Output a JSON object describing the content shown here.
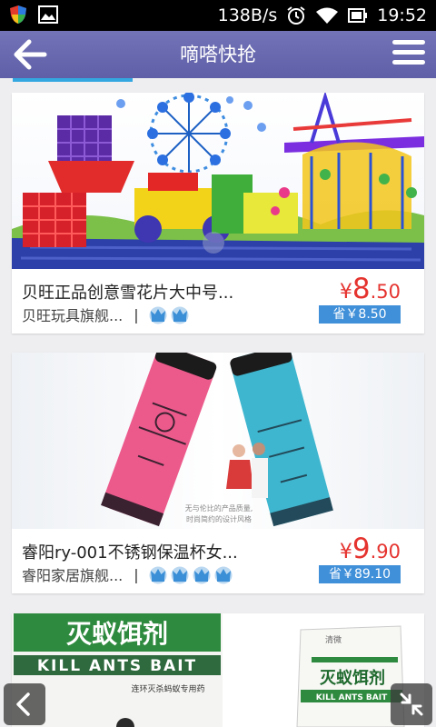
{
  "status_bar": {
    "speed": "138B/s",
    "time": "19:52",
    "icons": [
      "shield-icon",
      "image-icon",
      "alarm-icon",
      "wifi-icon",
      "battery-icon"
    ]
  },
  "app_bar": {
    "title": "嘀嗒快抢",
    "icons": [
      "back-arrow-icon",
      "hamburger-menu-icon"
    ],
    "color": "#6767af"
  },
  "tab_indicator_color": "#33a7e0",
  "products": [
    {
      "name": "贝旺正品创意雪花片大中号...",
      "shop": "贝旺玩具旗舰...",
      "separator": "|",
      "crown_count": 2,
      "price_currency": "¥",
      "price_integer": "8",
      "price_decimal": ".50",
      "save_label": "省￥8.50",
      "image": "snowflake-building-blocks-toy-image"
    },
    {
      "name": "睿阳ry-001不锈钢保温杯女...",
      "shop": "睿阳家居旗舰...",
      "separator": "|",
      "crown_count": 4,
      "price_currency": "¥",
      "price_integer": "9",
      "price_decimal": ".90",
      "save_label": "省￥89.10",
      "image": "insulated-tumbler-cups-image",
      "image_caption_line1": "无与伦比的产品质量,",
      "image_caption_line2": "时尚简约的设计风格"
    },
    {
      "image": "ant-bait-product-image",
      "image_text_main": "灭蚁饵剂",
      "image_text_english": "KILL ANTS BAIT",
      "image_text_sub": "连环灭杀蚂蚁专用药",
      "box_brand": "清微",
      "box_text_main": "灭蚁饵剂",
      "box_text_english": "KILL ANTS BAIT"
    }
  ],
  "floating_buttons": [
    "back-chevron-icon",
    "collapse-arrows-icon"
  ],
  "colors": {
    "price": "#e5332f",
    "save_badge": "#3f8fd9",
    "crown": "#3b8fd6"
  }
}
